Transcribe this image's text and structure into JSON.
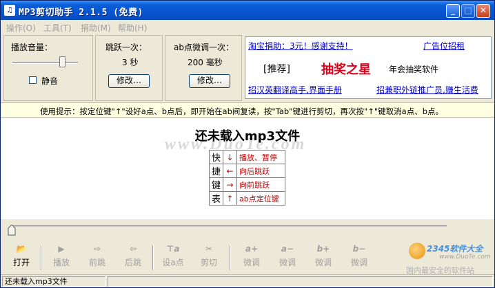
{
  "window": {
    "title": "MP3剪切助手 2.1.5 (免费)",
    "icon_text": "♫",
    "minimize_label": "_",
    "maximize_label": "□",
    "close_label": "✕"
  },
  "menu": [
    {
      "label": "操作(O)"
    },
    {
      "label": "工具(T)"
    },
    {
      "label": "捐助(M)"
    },
    {
      "label": "帮助(H)"
    }
  ],
  "volume_panel": {
    "label": "播放音量：",
    "mute_label": "静音",
    "mute_checked": false,
    "volume_level_fraction": 0.8
  },
  "jump_panel": {
    "label": "跳跃一次：",
    "value": "3 秒",
    "button_label": "修改…"
  },
  "ab_panel": {
    "label": "ab点微调一次：",
    "value": "200 毫秒",
    "button_label": "修改…"
  },
  "ad": {
    "link1": "淘宝捐助：3元！感谢支持！",
    "link2": "广告位招租",
    "recommend": "[推荐]",
    "star": "抽奖之星",
    "star_desc": "年会抽奖软件",
    "link3": "招汉英翻译高手,界面手册",
    "link4": "招兼职外链推广员,赚生活费"
  },
  "tip": "使用提示：按定位键\"↑\"设好a点、b点后，即开始在ab间复读，按\"Tab\"键进行剪切，再次按\"↑\"键取消a点、b点。",
  "main": {
    "status_title": "还未载入mp3文件",
    "watermark": "www.DuoTe.com",
    "shortcuts_header": [
      "快",
      "捷",
      "键",
      "表"
    ],
    "shortcuts": [
      {
        "arrow": "↓",
        "action": "播放、暂停"
      },
      {
        "arrow": "←",
        "action": "向后跳跃"
      },
      {
        "arrow": "→",
        "action": "向前跳跃"
      },
      {
        "arrow": "↑",
        "action": "ab点定位键"
      }
    ]
  },
  "seek": {
    "position_fraction": 0.0
  },
  "toolbar": [
    {
      "name": "open",
      "icon": "📂",
      "label": "打开",
      "enabled": true
    },
    {
      "name": "play",
      "icon": "▶",
      "label": "播放",
      "enabled": false
    },
    {
      "name": "jump-forward",
      "icon": "⇨",
      "label": "前跳",
      "enabled": false
    },
    {
      "name": "jump-back",
      "icon": "⇦",
      "label": "后跳",
      "enabled": false
    },
    {
      "name": "set-a",
      "icon": "⊤a",
      "label": "设a点",
      "enabled": false
    },
    {
      "name": "cut",
      "icon": "✂",
      "label": "剪切",
      "enabled": false
    },
    {
      "name": "a-plus",
      "icon": "a+",
      "label": "微调",
      "enabled": false
    },
    {
      "name": "a-minus",
      "icon": "a−",
      "label": "微调",
      "enabled": false
    },
    {
      "name": "b-plus",
      "icon": "b+",
      "label": "微调",
      "enabled": false
    },
    {
      "name": "b-minus",
      "icon": "b−",
      "label": "微调",
      "enabled": false
    }
  ],
  "status": {
    "text": "还未载入mp3文件"
  },
  "brand": {
    "name": "2345软件大全",
    "site": "www.DuoTe.com",
    "slogan": "国内最安全的软件站"
  },
  "colors": {
    "titlebar": "#0854d0",
    "tip_bg": "#ffffe1",
    "link": "#0000cc",
    "accent_red": "#e0001b"
  }
}
